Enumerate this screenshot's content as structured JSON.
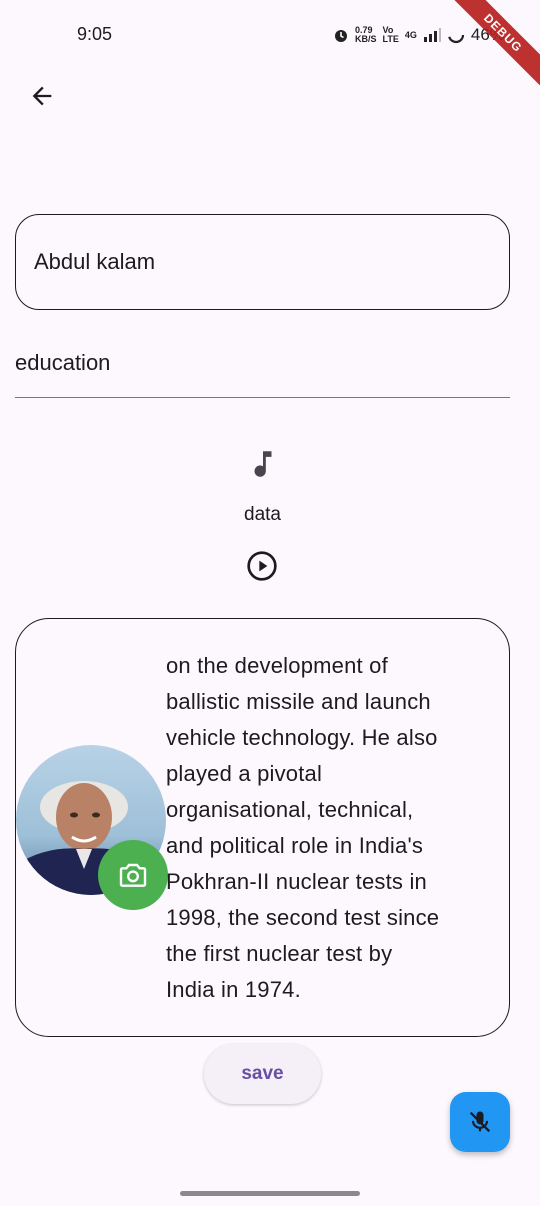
{
  "status_bar": {
    "time": "9:05",
    "speed_value": "0.79",
    "speed_unit": "KB/S",
    "volte_top": "Vo",
    "volte_bottom": "LTE",
    "network": "4G",
    "battery": "46%",
    "debug_label": "DEBUG"
  },
  "form": {
    "name_value": "Abdul kalam",
    "education_value": "education"
  },
  "audio": {
    "label": "data"
  },
  "bio": {
    "text": "on the development of\nballistic missile and launch\nvehicle technology. He also\nplayed a pivotal\norganisational, technical,\nand political role in India's\nPokhran-II nuclear tests in\n1998, the second test since\nthe first nuclear test by\nIndia in 1974."
  },
  "actions": {
    "save_label": "save"
  },
  "colors": {
    "accent": "#6750a4",
    "camera_button": "#4caf50",
    "mic_fab": "#2196f3",
    "debug_ribbon": "#b71c1c"
  }
}
